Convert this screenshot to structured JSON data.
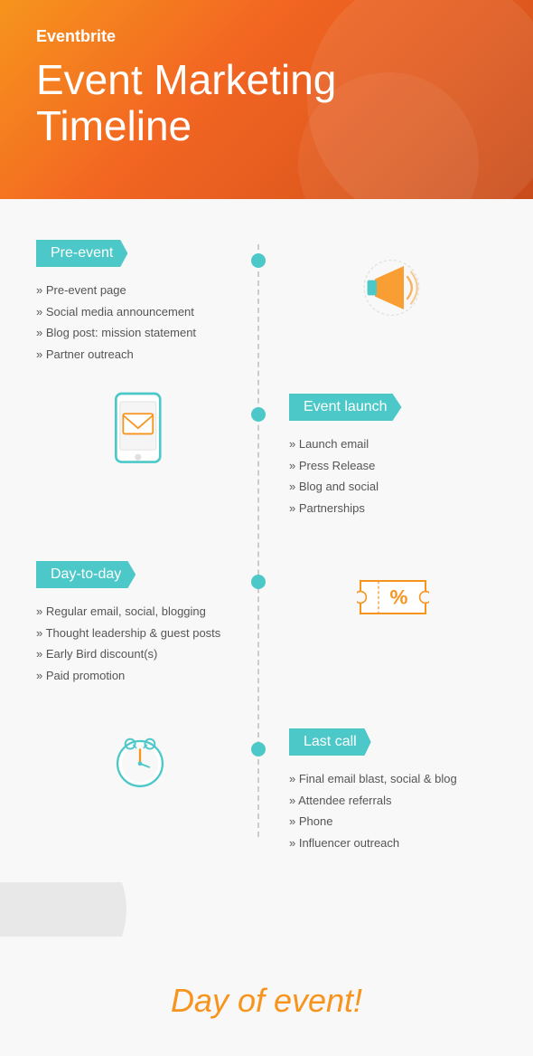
{
  "header": {
    "brand": "Eventbrite",
    "title_line1": "Event Marketing",
    "title_line2": "Timeline"
  },
  "sections": [
    {
      "id": "pre-event",
      "label": "Pre-event",
      "side": "left",
      "items": [
        "Pre-event page",
        "Social media announcement",
        "Blog post: mission statement",
        "Partner outreach"
      ],
      "icon": "megaphone"
    },
    {
      "id": "event-launch",
      "label": "Event launch",
      "side": "right",
      "items": [
        "Launch email",
        "Press Release",
        "Blog and social",
        "Partnerships"
      ],
      "icon": "phone"
    },
    {
      "id": "day-to-day",
      "label": "Day-to-day",
      "side": "left",
      "items": [
        "Regular email, social, blogging",
        "Thought leadership & guest posts",
        "Early Bird discount(s)",
        "Paid promotion"
      ],
      "icon": "ticket"
    },
    {
      "id": "last-call",
      "label": "Last call",
      "side": "right",
      "items": [
        "Final email blast, social & blog",
        "Attendee referrals",
        "Phone",
        "Influencer outreach"
      ],
      "icon": "clock"
    }
  ],
  "footer": {
    "text": "Day of event!"
  }
}
